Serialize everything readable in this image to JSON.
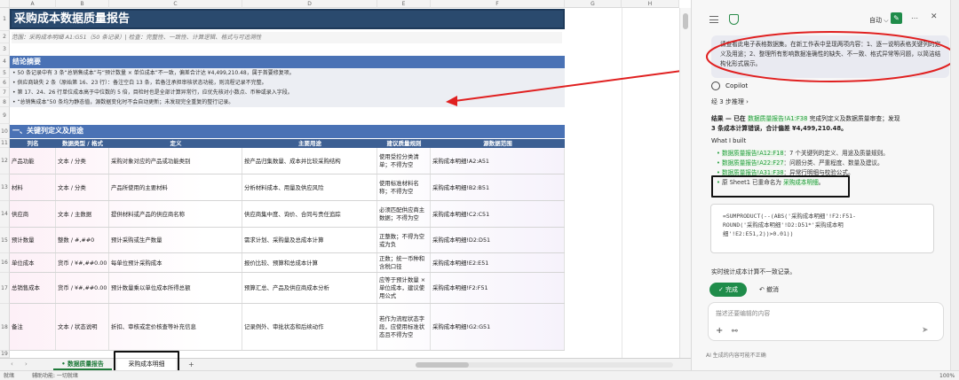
{
  "sheet": {
    "columns": [
      "A",
      "B",
      "C",
      "D",
      "E",
      "F",
      "G",
      "H",
      "I"
    ],
    "rows": [
      "1",
      "2",
      "3",
      "4",
      "5",
      "6",
      "7",
      "8",
      "9",
      "10",
      "11",
      "12",
      "13",
      "14",
      "15",
      "16",
      "17",
      "18",
      "19",
      "20"
    ],
    "title": "采购成本数据质量报告",
    "subtitle": "范围：采购成本明细 A1:G51（50 条记录）| 检查：完整性、一致性、计算逻辑、格式与可追溯性",
    "summary_header": "结论摘要",
    "summary": [
      "• 50 条记录中有 3 条“总销售成本”与“预计数量 × 单位成本”不一致，偏差合计达 ¥4,499,210.48，属于首要修复项。",
      "• 供应商缺失 2 条（原始第 16、23 行）：备注空白 13 条，若备注承担审核状态功能，则流程记录不完整。",
      "• 第 17、24、26 行单位成本高于中位数的 5 倍，目检时也是全部计算异常行，应优先核对小数点、币种或录入字段。",
      "• “总销售成本”50 条均为静态值，源数据变化时不会自动更新；未发现完全重复的整行记录。"
    ],
    "section1": "一、关键列定义及用途",
    "headers": [
      "列名",
      "数据类型 / 格式",
      "定义",
      "主要用途",
      "建议质量规则",
      "源数据范围"
    ],
    "rows_data": [
      [
        "产品功能",
        "文本 / 分类",
        "采购对象对应的产品或功能类别",
        "按产品归集数量、成本并比较采购结构",
        "使用受控分类清单；不得为空",
        "采购成本明细!A2:A51"
      ],
      [
        "材料",
        "文本 / 分类",
        "产品所使用的主要材料",
        "分析材料成本、用量及供应风险",
        "使用标准材料名称；不得为空",
        "采购成本明细!B2:B51"
      ],
      [
        "供应商",
        "文本 / 主数据",
        "提供材料或产品的供应商名称",
        "供应商集中度、询价、合同与责任追踪",
        "必须匹配供应商主数据；不得为空",
        "采购成本明细!C2:C51"
      ],
      [
        "预计数量",
        "整数 / #,##0",
        "预计采购或生产数量",
        "需求计划、采购量及总成本计算",
        "正整数；不得为空或为负",
        "采购成本明细!D2:D51"
      ],
      [
        "单位成本",
        "货币 / ¥#,##0.00",
        "每单位预计采购成本",
        "报价比较、预算和总成本计算",
        "正数；统一币种和含税口径",
        "采购成本明细!E2:E51"
      ],
      [
        "总销售成本",
        "货币 / ¥#,##0.00",
        "预计数量乘以单位成本所得总额",
        "预算汇总、产品及供应商成本分析",
        "应等于预计数量 × 单位成本，建议使用公式",
        "采购成本明细!F2:F51"
      ],
      [
        "备注",
        "文本 / 状态说明",
        "折扣、审核或定价核查等补充信息",
        "记录例外、审批状态和后续动作",
        "若作为流程状态字段，应使用标准状态且不得为空",
        "采购成本明细!G2:G51"
      ]
    ],
    "tabs": [
      "数据质量报告",
      "采购成本明细"
    ],
    "add_tab": "+"
  },
  "status": {
    "left": "就绪",
    "accessibility": "辅助功能: 一切就绪",
    "zoom": "100%"
  },
  "copilot": {
    "mode": "自动",
    "prompt": "请查看此电子表格数据集。在新工作表中呈现两项内容：1、逐一说明表格关键列的定义及用途；2、整理所有影响数据准确性的缺失、不一致、格式异常等问题，以简洁结构化形式展示。",
    "name": "Copilot",
    "steps": "经 3 步推理",
    "result_pre": "结果 — 已在 ",
    "result_link": "数据质量报告!A1:F38",
    "result_post": " 完成列定义及数据质量审查；发现",
    "result_bold": "3 条成本计算错误，合计偏差 ¥4,499,210.48。",
    "built_title": "What I built",
    "built": [
      {
        "link": "数据质量报告!A12:F18",
        "text": "：7 个关键列的定义、用途及质量规则。"
      },
      {
        "link": "数据质量报告!A22:F27",
        "text": "：问题分类、严重程度、数量及建议。"
      },
      {
        "link": "数据质量报告!A31:F38",
        "text": "：异常行明细与校验公式。"
      }
    ],
    "renamed_pre": "原 Sheet1 已重命名为 ",
    "renamed_link": "采购成本明细",
    "renamed_post": "。",
    "code": "=SUMPRODUCT(--(ABS('采购成本明细'!F2:F51-ROUND('采购成本明细'!D2:D51*'采购成本明细'!E2:E51,2))>0.01))",
    "code_lines": [
      "=SUMPRODUCT(--(ABS('采购成本明细'!F2:F51-",
      "ROUND('采购成本明细'!D2:D51*'采购成本明",
      "细'!E2:E51,2))>0.01))"
    ],
    "after_code": "实时统计成本计算不一致记录。",
    "done": "完成",
    "undo": "撤消",
    "input_placeholder": "描述还要编辑的内容",
    "disclaimer": "AI 生成的内容可能不正确"
  }
}
